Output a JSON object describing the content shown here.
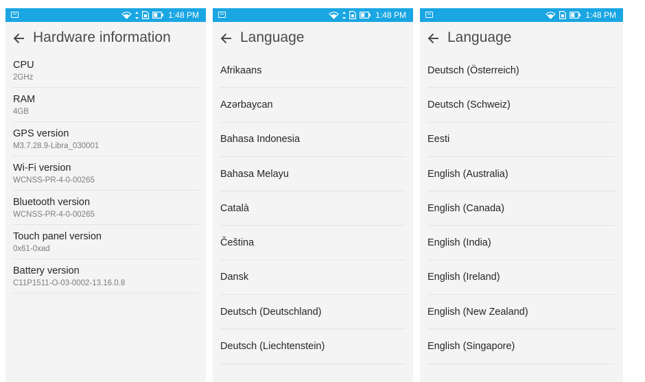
{
  "colors": {
    "status_bar": "#1aa6e2",
    "background": "#f4f4f4",
    "divider": "#e3e3e3",
    "primary_text": "#262626",
    "secondary_text": "#7d7d7d"
  },
  "status_bar": {
    "time": "1:48 PM",
    "icons": [
      "notification-icon",
      "wifi-icon",
      "data-arrows-icon",
      "sim-icon",
      "battery-icon"
    ]
  },
  "hardware_screen": {
    "title": "Hardware information",
    "items": [
      {
        "label": "CPU",
        "value": "2GHz"
      },
      {
        "label": "RAM",
        "value": "4GB"
      },
      {
        "label": "GPS version",
        "value": "M3.7.28.9-Libra_030001"
      },
      {
        "label": "Wi-Fi version",
        "value": "WCNSS-PR-4-0-00265"
      },
      {
        "label": "Bluetooth version",
        "value": "WCNSS-PR-4-0-00265"
      },
      {
        "label": "Touch panel version",
        "value": "0x61-0xad"
      },
      {
        "label": "Battery version",
        "value": "C11P1511-O-03-0002-13.16.0.8"
      }
    ]
  },
  "language_screen_1": {
    "title": "Language",
    "items": [
      "Afrikaans",
      "Azərbaycan",
      "Bahasa Indonesia",
      "Bahasa Melayu",
      "Català",
      "Čeština",
      "Dansk",
      "Deutsch (Deutschland)",
      "Deutsch (Liechtenstein)"
    ]
  },
  "language_screen_2": {
    "title": "Language",
    "items": [
      "Deutsch (Österreich)",
      "Deutsch (Schweiz)",
      "Eesti",
      "English (Australia)",
      "English (Canada)",
      "English (India)",
      "English (Ireland)",
      "English (New Zealand)",
      "English (Singapore)"
    ]
  }
}
